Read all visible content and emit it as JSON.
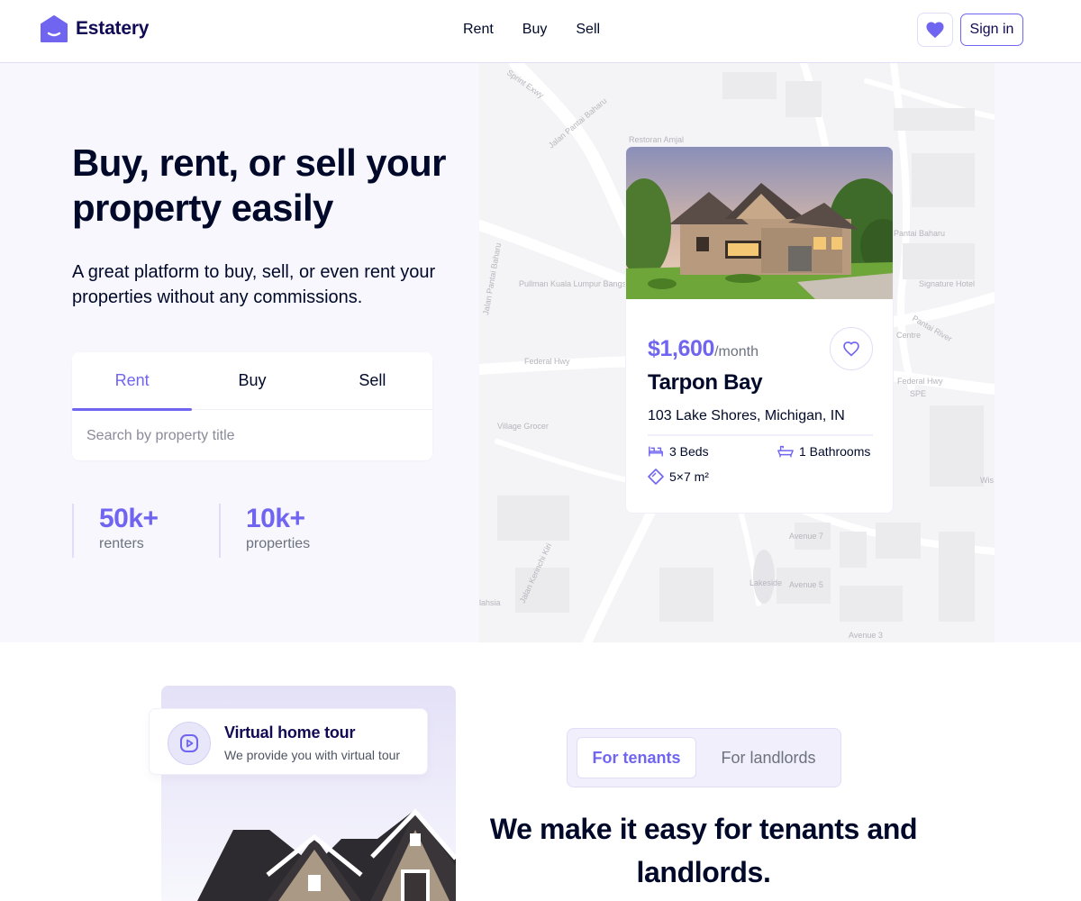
{
  "brand": {
    "name": "Estatery",
    "accent": "#7065f0",
    "dark": "#100a55"
  },
  "nav": {
    "links": [
      "Rent",
      "Buy",
      "Sell"
    ],
    "favorite_icon": "heart-icon",
    "signin_label": "Sign in"
  },
  "hero": {
    "title": "Buy, rent, or sell your property easily",
    "subtitle": "A great platform to buy, sell, or even rent your properties without any commissions.",
    "search": {
      "tabs": [
        "Rent",
        "Buy",
        "Sell"
      ],
      "active_tab": "Rent",
      "placeholder": "Search by property title",
      "value": ""
    },
    "stats": [
      {
        "value": "50k+",
        "label": "renters"
      },
      {
        "value": "10k+",
        "label": "properties"
      }
    ]
  },
  "map_labels": [
    "Sprint Exwy",
    "Jalan Pantai Baharu",
    "Restoran Amjal",
    "Pantai Baharu",
    "Signature Hotel",
    "Pantai River",
    "Centre",
    "Federal Hwy",
    "SPE",
    "Pullman Kuala Lumpur Bangsar Hotel",
    "Jalan Pantai Baharu",
    "Federal Hwy",
    "Village Grocer",
    "Avenue 7",
    "Lakeside",
    "Avenue 5",
    "Avenue 3",
    "Jalan Kerinchi Kiri",
    "Wis",
    "lahsia"
  ],
  "property": {
    "price": "$1,600",
    "period": "/month",
    "name": "Tarpon Bay",
    "address": "103 Lake Shores, Michigan, IN",
    "beds": "3 Beds",
    "baths": "1 Bathrooms",
    "area": "5×7 m²",
    "icons": {
      "beds": "bed-icon",
      "baths": "bathtub-icon",
      "area": "area-icon",
      "favorite": "heart-outline-icon"
    }
  },
  "tour": {
    "title": "Virtual home tour",
    "subtitle": "We provide you with virtual tour",
    "icon": "play-icon"
  },
  "audience": {
    "options": [
      "For tenants",
      "For landlords"
    ],
    "active": "For tenants"
  },
  "section": {
    "title": "We make it easy for tenants and landlords."
  }
}
